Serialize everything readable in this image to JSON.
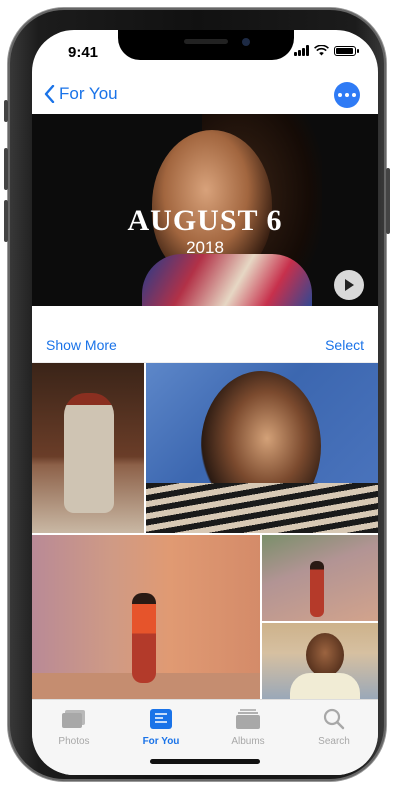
{
  "status_bar": {
    "time": "9:41"
  },
  "nav": {
    "back_label": "For You"
  },
  "memory": {
    "title": "AUGUST 6",
    "year": "2018"
  },
  "actions": {
    "show_more": "Show More",
    "select": "Select"
  },
  "tab_bar": {
    "tabs": [
      {
        "label": "Photos",
        "icon": "photos-icon",
        "active": false
      },
      {
        "label": "For You",
        "icon": "for-you-icon",
        "active": true
      },
      {
        "label": "Albums",
        "icon": "albums-icon",
        "active": false
      },
      {
        "label": "Search",
        "icon": "search-icon",
        "active": false
      }
    ]
  },
  "colors": {
    "accent": "#1a73e8",
    "more_button": "#2f7bf5",
    "inactive_tab": "#a8a8a8"
  }
}
